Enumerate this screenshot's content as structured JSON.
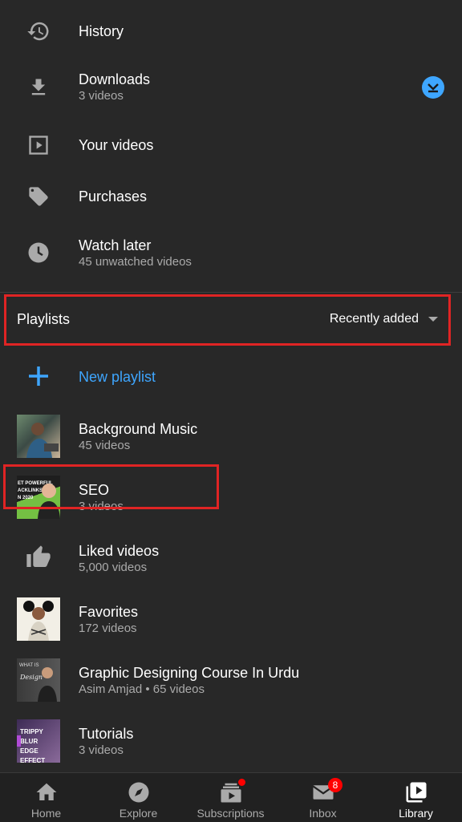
{
  "menu": [
    {
      "title": "History",
      "subtitle": "",
      "icon": "history-icon"
    },
    {
      "title": "Downloads",
      "subtitle": "3 videos",
      "icon": "download-icon"
    },
    {
      "title": "Your videos",
      "subtitle": "",
      "icon": "play-box-icon"
    },
    {
      "title": "Purchases",
      "subtitle": "",
      "icon": "tag-icon"
    },
    {
      "title": "Watch later",
      "subtitle": "45 unwatched videos",
      "icon": "clock-icon"
    }
  ],
  "playlists_header": {
    "label": "Playlists",
    "sort_label": "Recently added"
  },
  "new_playlist": {
    "label": "New playlist"
  },
  "playlists": [
    {
      "title": "Background Music",
      "subtitle": "45 videos"
    },
    {
      "title": "SEO",
      "subtitle": "3 videos",
      "thumb_text": [
        "ET POWERFUL",
        "ACKLINKS",
        "N 2020"
      ]
    },
    {
      "title": "Liked videos",
      "subtitle": "5,000 videos"
    },
    {
      "title": "Favorites",
      "subtitle": "172 videos"
    },
    {
      "title": "Graphic Designing Course In Urdu",
      "subtitle": "Asim Amjad • 65 videos",
      "thumb_text": [
        "WHAT IS"
      ]
    },
    {
      "title": "Tutorials",
      "subtitle": "3 videos",
      "thumb_text": [
        "TRIPPY BLUR",
        "EDGE EFFECT"
      ]
    }
  ],
  "bottom_nav": [
    {
      "label": "Home"
    },
    {
      "label": "Explore"
    },
    {
      "label": "Subscriptions"
    },
    {
      "label": "Inbox",
      "badge": "8"
    },
    {
      "label": "Library"
    }
  ],
  "colors": {
    "accent_blue": "#3ea6ff",
    "highlight_red": "#e02424",
    "badge_red": "#ff0000",
    "background": "#282828"
  }
}
